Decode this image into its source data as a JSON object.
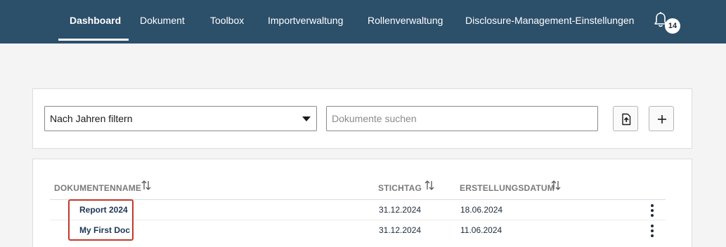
{
  "nav": {
    "items": [
      {
        "label": "Dashboard",
        "active": true
      },
      {
        "label": "Dokument",
        "active": false
      },
      {
        "label": "Toolbox",
        "active": false
      },
      {
        "label": "Importverwaltung",
        "active": false
      },
      {
        "label": "Rollenverwaltung",
        "active": false
      },
      {
        "label": "Disclosure-Management-Einstellungen",
        "active": false
      }
    ],
    "notification_count": "14"
  },
  "filter": {
    "year_select_value": "Nach Jahren filtern",
    "search_placeholder": "Dokumente suchen",
    "upload_icon": "file-upload-icon",
    "add_icon": "plus-icon"
  },
  "table": {
    "columns": {
      "name": "DOKUMENTENNAME",
      "stichtag": "STICHTAG",
      "erstellungsdatum": "ERSTELLUNGSDATUM"
    },
    "rows": [
      {
        "name": "Report 2024",
        "stichtag": "31.12.2024",
        "erstellungsdatum": "18.06.2024"
      },
      {
        "name": "My First Doc",
        "stichtag": "31.12.2024",
        "erstellungsdatum": "11.06.2024"
      }
    ]
  },
  "colors": {
    "topbar": "#2c4f6a",
    "background": "#f4f4f4",
    "highlight": "#c0392b"
  }
}
